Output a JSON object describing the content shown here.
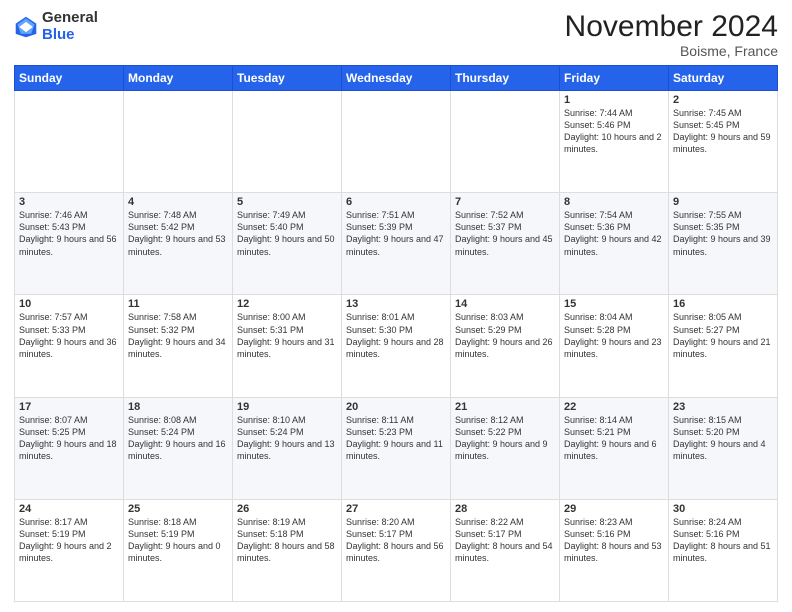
{
  "logo": {
    "general": "General",
    "blue": "Blue"
  },
  "title": "November 2024",
  "subtitle": "Boisme, France",
  "days_of_week": [
    "Sunday",
    "Monday",
    "Tuesday",
    "Wednesday",
    "Thursday",
    "Friday",
    "Saturday"
  ],
  "weeks": [
    [
      {
        "day": "",
        "info": ""
      },
      {
        "day": "",
        "info": ""
      },
      {
        "day": "",
        "info": ""
      },
      {
        "day": "",
        "info": ""
      },
      {
        "day": "",
        "info": ""
      },
      {
        "day": "1",
        "info": "Sunrise: 7:44 AM\nSunset: 5:46 PM\nDaylight: 10 hours and 2 minutes."
      },
      {
        "day": "2",
        "info": "Sunrise: 7:45 AM\nSunset: 5:45 PM\nDaylight: 9 hours and 59 minutes."
      }
    ],
    [
      {
        "day": "3",
        "info": "Sunrise: 7:46 AM\nSunset: 5:43 PM\nDaylight: 9 hours and 56 minutes."
      },
      {
        "day": "4",
        "info": "Sunrise: 7:48 AM\nSunset: 5:42 PM\nDaylight: 9 hours and 53 minutes."
      },
      {
        "day": "5",
        "info": "Sunrise: 7:49 AM\nSunset: 5:40 PM\nDaylight: 9 hours and 50 minutes."
      },
      {
        "day": "6",
        "info": "Sunrise: 7:51 AM\nSunset: 5:39 PM\nDaylight: 9 hours and 47 minutes."
      },
      {
        "day": "7",
        "info": "Sunrise: 7:52 AM\nSunset: 5:37 PM\nDaylight: 9 hours and 45 minutes."
      },
      {
        "day": "8",
        "info": "Sunrise: 7:54 AM\nSunset: 5:36 PM\nDaylight: 9 hours and 42 minutes."
      },
      {
        "day": "9",
        "info": "Sunrise: 7:55 AM\nSunset: 5:35 PM\nDaylight: 9 hours and 39 minutes."
      }
    ],
    [
      {
        "day": "10",
        "info": "Sunrise: 7:57 AM\nSunset: 5:33 PM\nDaylight: 9 hours and 36 minutes."
      },
      {
        "day": "11",
        "info": "Sunrise: 7:58 AM\nSunset: 5:32 PM\nDaylight: 9 hours and 34 minutes."
      },
      {
        "day": "12",
        "info": "Sunrise: 8:00 AM\nSunset: 5:31 PM\nDaylight: 9 hours and 31 minutes."
      },
      {
        "day": "13",
        "info": "Sunrise: 8:01 AM\nSunset: 5:30 PM\nDaylight: 9 hours and 28 minutes."
      },
      {
        "day": "14",
        "info": "Sunrise: 8:03 AM\nSunset: 5:29 PM\nDaylight: 9 hours and 26 minutes."
      },
      {
        "day": "15",
        "info": "Sunrise: 8:04 AM\nSunset: 5:28 PM\nDaylight: 9 hours and 23 minutes."
      },
      {
        "day": "16",
        "info": "Sunrise: 8:05 AM\nSunset: 5:27 PM\nDaylight: 9 hours and 21 minutes."
      }
    ],
    [
      {
        "day": "17",
        "info": "Sunrise: 8:07 AM\nSunset: 5:25 PM\nDaylight: 9 hours and 18 minutes."
      },
      {
        "day": "18",
        "info": "Sunrise: 8:08 AM\nSunset: 5:24 PM\nDaylight: 9 hours and 16 minutes."
      },
      {
        "day": "19",
        "info": "Sunrise: 8:10 AM\nSunset: 5:24 PM\nDaylight: 9 hours and 13 minutes."
      },
      {
        "day": "20",
        "info": "Sunrise: 8:11 AM\nSunset: 5:23 PM\nDaylight: 9 hours and 11 minutes."
      },
      {
        "day": "21",
        "info": "Sunrise: 8:12 AM\nSunset: 5:22 PM\nDaylight: 9 hours and 9 minutes."
      },
      {
        "day": "22",
        "info": "Sunrise: 8:14 AM\nSunset: 5:21 PM\nDaylight: 9 hours and 6 minutes."
      },
      {
        "day": "23",
        "info": "Sunrise: 8:15 AM\nSunset: 5:20 PM\nDaylight: 9 hours and 4 minutes."
      }
    ],
    [
      {
        "day": "24",
        "info": "Sunrise: 8:17 AM\nSunset: 5:19 PM\nDaylight: 9 hours and 2 minutes."
      },
      {
        "day": "25",
        "info": "Sunrise: 8:18 AM\nSunset: 5:19 PM\nDaylight: 9 hours and 0 minutes."
      },
      {
        "day": "26",
        "info": "Sunrise: 8:19 AM\nSunset: 5:18 PM\nDaylight: 8 hours and 58 minutes."
      },
      {
        "day": "27",
        "info": "Sunrise: 8:20 AM\nSunset: 5:17 PM\nDaylight: 8 hours and 56 minutes."
      },
      {
        "day": "28",
        "info": "Sunrise: 8:22 AM\nSunset: 5:17 PM\nDaylight: 8 hours and 54 minutes."
      },
      {
        "day": "29",
        "info": "Sunrise: 8:23 AM\nSunset: 5:16 PM\nDaylight: 8 hours and 53 minutes."
      },
      {
        "day": "30",
        "info": "Sunrise: 8:24 AM\nSunset: 5:16 PM\nDaylight: 8 hours and 51 minutes."
      }
    ]
  ]
}
